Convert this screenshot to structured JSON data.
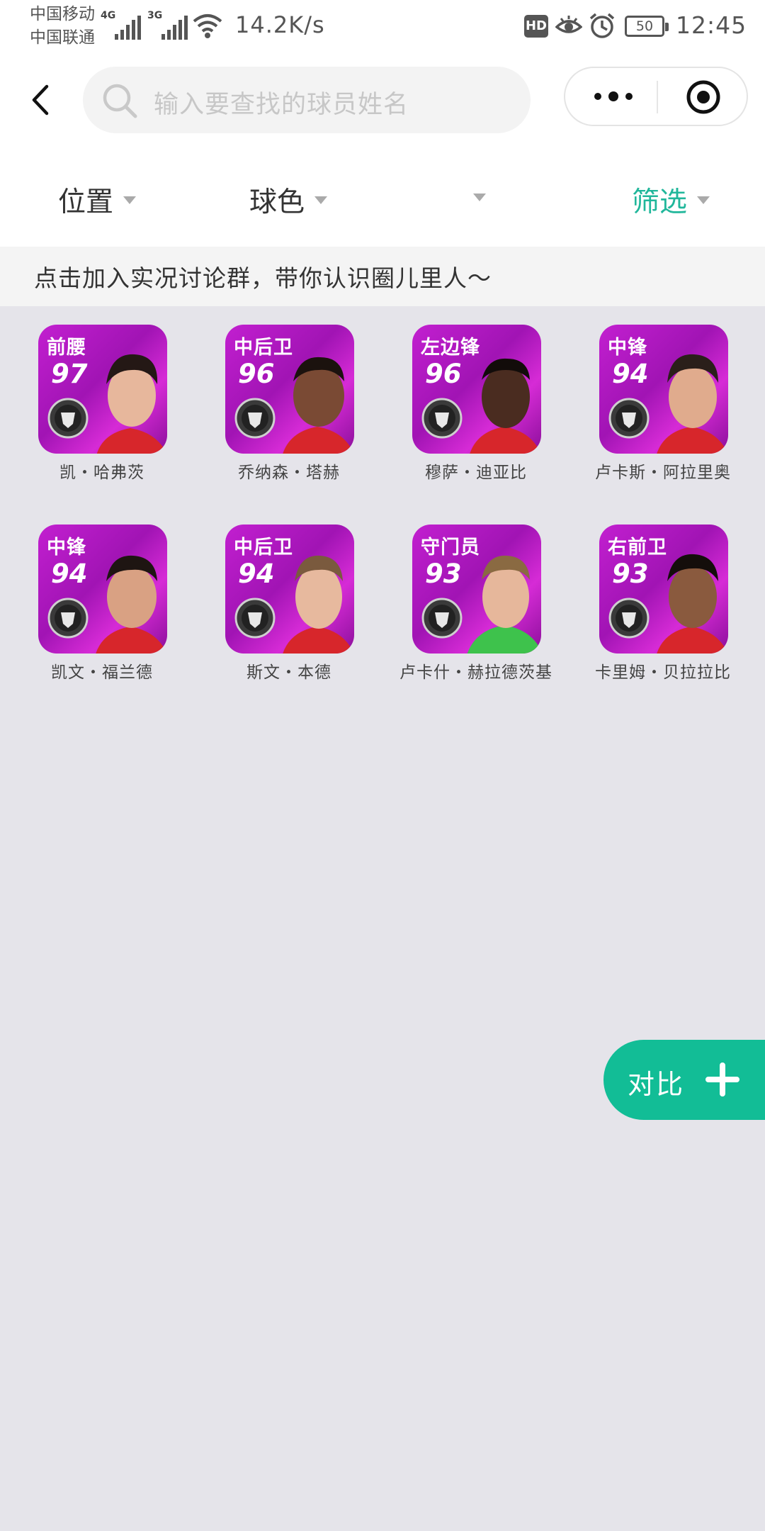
{
  "status_bar": {
    "carrier_1": "中国移动",
    "carrier_2": "中国联通",
    "network_1": "4G",
    "network_2": "3G",
    "speed": "14.2K/s",
    "hd": "HD",
    "battery": "50",
    "time": "12:45"
  },
  "header": {
    "search_placeholder": "输入要查找的球员姓名"
  },
  "filters": [
    {
      "label": "位置",
      "active": false
    },
    {
      "label": "球色",
      "active": false
    },
    {
      "label": "",
      "active": false
    },
    {
      "label": "筛选",
      "active": true
    }
  ],
  "banner": "点击加入实况讨论群，带你认识圈儿里人～",
  "players": [
    {
      "position": "前腰",
      "rating": "97",
      "name": "凯・哈弗茨"
    },
    {
      "position": "中后卫",
      "rating": "96",
      "name": "乔纳森・塔赫"
    },
    {
      "position": "左边锋",
      "rating": "96",
      "name": "穆萨・迪亚比"
    },
    {
      "position": "中锋",
      "rating": "94",
      "name": "卢卡斯・阿拉里奥"
    },
    {
      "position": "中锋",
      "rating": "94",
      "name": "凯文・福兰德"
    },
    {
      "position": "中后卫",
      "rating": "94",
      "name": "斯文・本德"
    },
    {
      "position": "守门员",
      "rating": "93",
      "name": "卢卡什・赫拉德茨基"
    },
    {
      "position": "右前卫",
      "rating": "93",
      "name": "卡里姆・贝拉拉比"
    }
  ],
  "compare_button": "对比",
  "colors": {
    "accent": "#21b79b",
    "compare_bg": "#12bd96",
    "card_purple": "#b21ac4",
    "page_bg": "#e5e4ea"
  }
}
